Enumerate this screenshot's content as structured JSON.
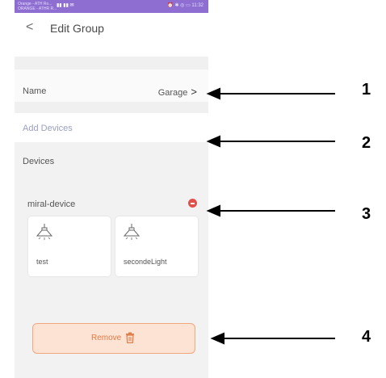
{
  "status_bar": {
    "carrier": "Orange - ATH Ro...",
    "carrier2": "ORANGE - ATHR R...",
    "time": "11:32"
  },
  "header": {
    "title": "Edit Group"
  },
  "name_row": {
    "label": "Name",
    "value": "Garage"
  },
  "add_devices": {
    "label": "Add Devices"
  },
  "devices": {
    "title": "Devices",
    "group_name": "miral-device",
    "items": [
      {
        "label": "test",
        "icon": "ceiling-lamp-icon"
      },
      {
        "label": "secondeLight",
        "icon": "ceiling-lamp-icon"
      }
    ]
  },
  "remove_button": {
    "label": "Remove",
    "icon": "trash-icon"
  },
  "annotations": [
    "1",
    "2",
    "3",
    "4"
  ],
  "colors": {
    "status_bar": "#8e6fd1",
    "accent_orange": "#e07a46",
    "remove_dot": "#e2504c",
    "remove_btn_bg": "#fde3d3"
  }
}
